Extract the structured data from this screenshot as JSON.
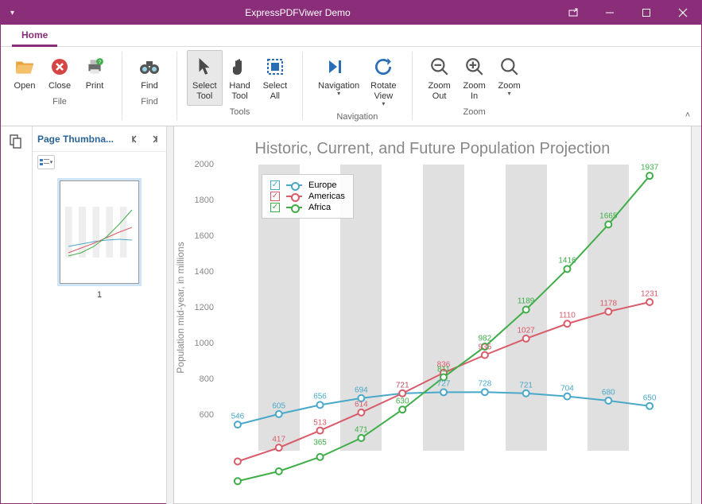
{
  "window": {
    "title": "ExpressPDFViwer Demo"
  },
  "tabs": {
    "home": "Home"
  },
  "ribbon": {
    "file": {
      "label": "File",
      "open": "Open",
      "close": "Close",
      "print": "Print"
    },
    "find": {
      "label": "Find",
      "find": "Find"
    },
    "tools": {
      "label": "Tools",
      "select_tool": "Select\nTool",
      "hand_tool": "Hand\nTool",
      "select_all": "Select\nAll"
    },
    "navigation": {
      "label": "Navigation",
      "navigation": "Navigation",
      "rotate_view": "Rotate\nView"
    },
    "zoom": {
      "label": "Zoom",
      "zoom_out": "Zoom\nOut",
      "zoom_in": "Zoom\nIn",
      "zoom": "Zoom"
    }
  },
  "thumbs": {
    "title": "Page Thumbna...",
    "page1": "1"
  },
  "chart_data": {
    "type": "line",
    "title": "Historic, Current, and Future Population Projection",
    "ylabel": "Population mid-year, in millions",
    "ylim": [
      400,
      2000
    ],
    "yticks": [
      600,
      800,
      1000,
      1200,
      1400,
      1600,
      1800,
      2000
    ],
    "x_count": 11,
    "series": [
      {
        "name": "Europe",
        "color": "#4aa8c9",
        "values": [
          546,
          605,
          656,
          694,
          721,
          727,
          728,
          721,
          704,
          680,
          650
        ]
      },
      {
        "name": "Americas",
        "color": "#d95c6a",
        "values": [
          340,
          417,
          513,
          614,
          721,
          836,
          935,
          1027,
          1110,
          1178,
          1231
        ]
      },
      {
        "name": "Africa",
        "color": "#3fae49",
        "values": [
          230,
          285,
          365,
          471,
          630,
          811,
          982,
          1189,
          1416,
          1665,
          1937
        ]
      }
    ]
  }
}
